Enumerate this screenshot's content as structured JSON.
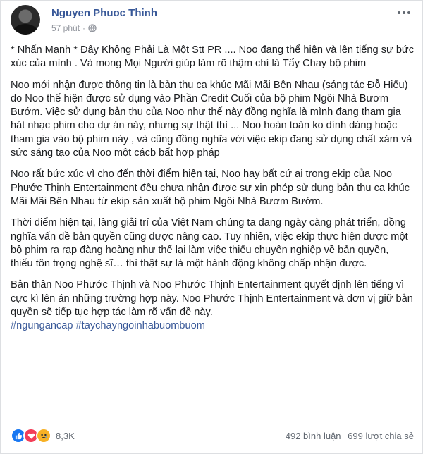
{
  "post": {
    "author": "Nguyen Phuoc Thinh",
    "time": "57 phút",
    "dot": "·",
    "paragraphs": [
      "* Nhấn Mạnh * Đây Không Phải Là Một Stt PR .... Noo đang thể hiện và lên tiếng sự bức xúc của mình . Và mong Mọi Người giúp làm rõ thậm chí là Tẩy Chay bộ phim",
      "Noo mới nhận được thông tin là bản thu ca khúc Mãi Mãi Bên Nhau (sáng tác Đỗ Hiếu) do Noo thể hiện được sử dụng vào Phần Credit Cuối của bộ phim Ngôi Nhà Bươm Bướm. Việc sử dụng bản thu của Noo như thế này đồng nghĩa là mình đang tham gia hát nhạc phim cho dự án này, nhưng sự thật thì ... Noo hoàn toàn ko dính dáng hoặc tham gia vào bộ phim này , và cũng đồng nghĩa với việc ekip đang sử dụng chất xám và sức sáng tạo của Noo một cácb bất hợp pháp",
      "Noo rất bức xúc vì cho đến thời điểm hiện tại, Noo hay bất cứ ai trong ekip của Noo Phước Thịnh Entertainment đều chưa nhận được sự xin phép sử dụng bản thu ca khúc Mãi Mãi Bên Nhau từ ekip sản xuất bộ phim Ngôi Nhà Bươm Bướm.",
      "Thời điểm hiện tại, làng giải trí của Việt Nam chúng ta đang ngày càng phát triển, đồng nghĩa vấn đề bản quyền cũng được nâng cao. Tuy nhiên, việc ekip thực hiện được một bộ phim ra rạp đàng hoàng như thế lại làm việc thiếu chuyên nghiệp về bản quyền, thiếu tôn trọng nghệ sĩ… thì thật sự là một hành động không chấp nhận được.",
      "Bản thân Noo Phước Thịnh và Noo Phước Thịnh Entertainment quyết định lên tiếng vì cực kì lên án những trường hợp này. Noo Phước Thịnh Entertainment và đơn vị giữ bản quyền sẽ tiếp tục hợp tác làm rõ vấn đề này."
    ],
    "hashtags": [
      "#ngungancap",
      "#taychayngoinhabuombuom"
    ]
  },
  "footer": {
    "reaction_count": "8,3K",
    "comments": "492 bình luận",
    "shares": "699 lượt chia sẻ"
  },
  "colors": {
    "link": "#385898",
    "like": "#1877f2",
    "love": "#f33e58",
    "sad": "#f7b125"
  },
  "icons": [
    "avatar",
    "globe-icon",
    "more-options-icon",
    "like-reaction-icon",
    "love-reaction-icon",
    "sad-reaction-icon"
  ]
}
